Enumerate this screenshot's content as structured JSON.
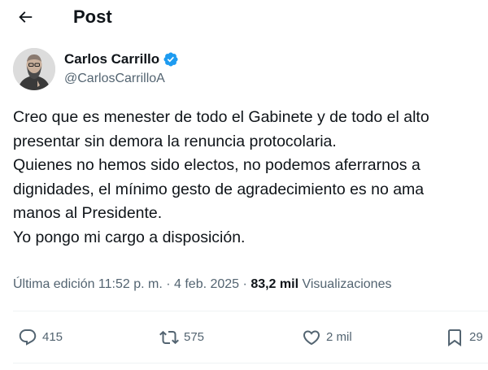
{
  "header": {
    "title": "Post",
    "back_icon": "arrow-left-icon"
  },
  "author": {
    "name": "Carlos Carrillo",
    "handle": "@CarlosCarrilloA",
    "verified_icon": "verified-badge-icon",
    "verified_color": "#1d9bf0"
  },
  "tweet": {
    "lines": [
      "Creo que es menester de todo el Gabinete y de todo el alto",
      "presentar sin demora la renuncia protocolaria.",
      "Quienes no hemos sido electos, no podemos aferrarnos a",
      "dignidades, el mínimo gesto de agradecimiento es no ama",
      "manos al Presidente.",
      "Yo pongo mi cargo a disposición."
    ]
  },
  "meta": {
    "edited_text": "Última edición 11:52 p. m. · 4 feb. 2025",
    "separator": "·",
    "views_count": "83,2 mil",
    "views_label": "Visualizaciones"
  },
  "actions": {
    "reply": {
      "icon": "reply-icon",
      "count": "415"
    },
    "repost": {
      "icon": "repost-icon",
      "count": "575"
    },
    "like": {
      "icon": "heart-icon",
      "count": "2 mil"
    },
    "bookmark": {
      "icon": "bookmark-icon",
      "count": "29"
    }
  },
  "colors": {
    "text": "#0f1419",
    "secondary": "#536471",
    "divider": "#eff3f4",
    "accent": "#1d9bf0"
  }
}
